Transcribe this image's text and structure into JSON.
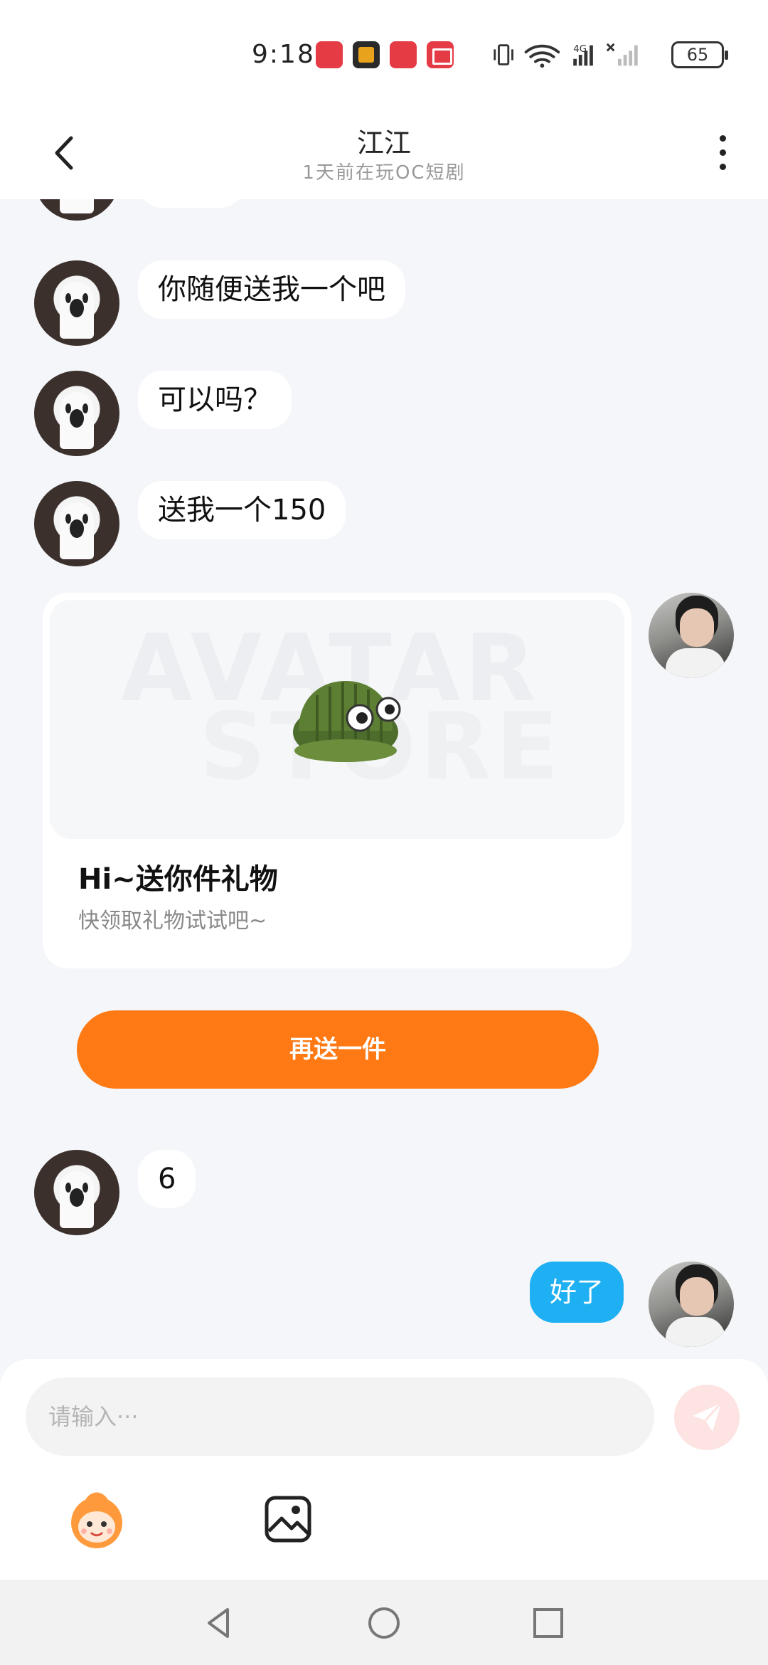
{
  "status_bar": {
    "time": "9:18",
    "battery": "65",
    "network": "4G",
    "app_icons": [
      "huawei-store-icon",
      "game-app-icon",
      "huawei-store-icon",
      "book-app-icon"
    ]
  },
  "header": {
    "title": "江江",
    "subtitle": "1天前在玩OC短剧"
  },
  "messages": [
    {
      "from": "other",
      "text": "你随便送我一个吧"
    },
    {
      "from": "other",
      "text": "可以吗？"
    },
    {
      "from": "other",
      "text": "送我一个150"
    },
    {
      "from": "other",
      "text": "6"
    },
    {
      "from": "me",
      "text": "好了"
    }
  ],
  "gift_card": {
    "watermark_top": "AVATAR",
    "watermark_bottom": "STORE",
    "title": "Hi~送你件礼物",
    "subtitle": "快领取礼物试试吧~",
    "button_label": "再送一件"
  },
  "composer": {
    "placeholder": "请输入···"
  },
  "colors": {
    "accent_orange": "#ff7a14",
    "my_bubble": "#1eb0f2",
    "background": "#f4f6f9"
  }
}
